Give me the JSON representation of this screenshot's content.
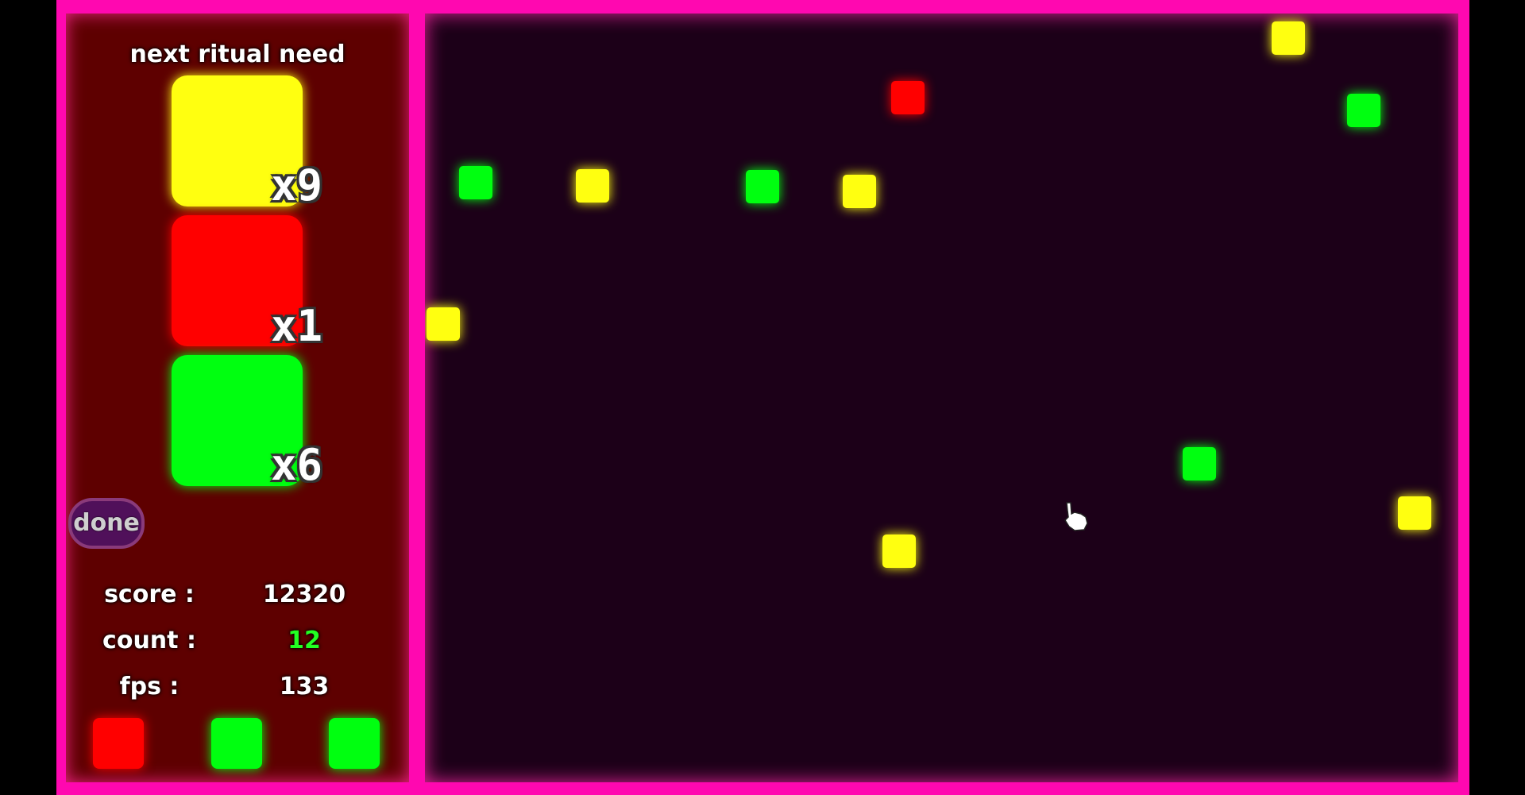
{
  "colors": {
    "yellow": "#ffff10",
    "red": "#ff0000",
    "green": "#00ff10",
    "frame": "#ff08b0",
    "sidebar_bg": "#5e0000",
    "playfield_bg": "#1c0018",
    "count_value": "#22ff22"
  },
  "ritual": {
    "heading": "next ritual need",
    "needs": [
      {
        "color": "yellow",
        "count": "x9"
      },
      {
        "color": "red",
        "count": "x1"
      },
      {
        "color": "green",
        "count": "x6"
      }
    ],
    "done_label": "done"
  },
  "stats": {
    "score_label": "score :",
    "score_value": "12320",
    "count_label": "count :",
    "count_value": "12",
    "fps_label": "fps :",
    "fps_value": "133"
  },
  "inventory": [
    "red",
    "green",
    "green"
  ],
  "playfield": {
    "pieces": [
      "yellow",
      "red",
      "green",
      "green",
      "yellow",
      "green",
      "yellow",
      "yellow",
      "green",
      "yellow",
      "yellow"
    ],
    "cursor_icon": "hand-pointer-icon"
  }
}
